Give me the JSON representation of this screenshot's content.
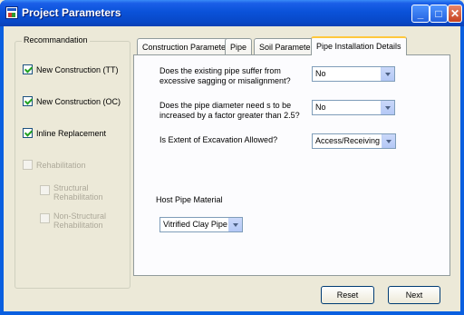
{
  "window": {
    "title": "Project Parameters",
    "minimize": "_",
    "maximize": "□",
    "close": "✕"
  },
  "recommendation": {
    "title": "Recommandation",
    "options": [
      {
        "label": "New Construction (TT)",
        "checked": true,
        "enabled": true
      },
      {
        "label": "New Construction (OC)",
        "checked": true,
        "enabled": true
      },
      {
        "label": "Inline Replacement",
        "checked": true,
        "enabled": true
      },
      {
        "label": "Rehabilitation",
        "checked": false,
        "enabled": false
      },
      {
        "label": "Structural Rehabilitation",
        "checked": false,
        "enabled": false
      },
      {
        "label": "Non-Structural Rehabilitation",
        "checked": false,
        "enabled": false
      }
    ]
  },
  "tabs": [
    "Construction Parameters",
    "Pipe",
    "Soil Parameter",
    "Pipe Installation Details"
  ],
  "active_tab": "Pipe Installation Details",
  "questions": [
    {
      "label": "Does the existing pipe suffer from excessive sagging or misalignment?",
      "value": "No"
    },
    {
      "label": "Does the pipe diameter need s to be increased by a factor greater than 2.5?",
      "value": "No"
    },
    {
      "label": "Is Extent of Excavation Allowed?",
      "value": "Access/Receiving p"
    }
  ],
  "host_pipe": {
    "label": "Host Pipe Material",
    "value": "Vitrified Clay Pipe"
  },
  "buttons": {
    "reset": "Reset",
    "next": "Next"
  }
}
